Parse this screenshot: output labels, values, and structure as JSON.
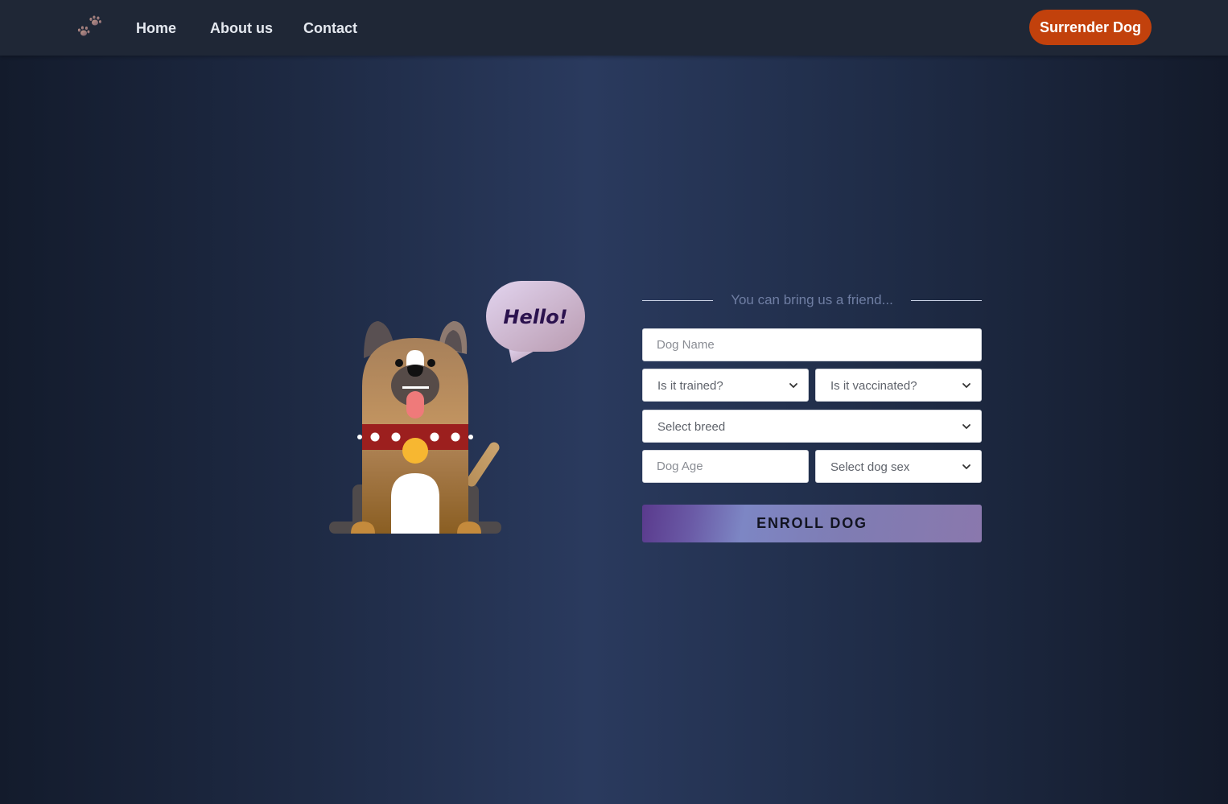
{
  "nav": {
    "links": [
      {
        "label": "Home"
      },
      {
        "label": "About us"
      },
      {
        "label": "Contact"
      }
    ],
    "cta_label": "Surrender Dog"
  },
  "illustration": {
    "speech_bubble": "Hello!"
  },
  "form": {
    "heading": "You can bring us a friend...",
    "dog_name_placeholder": "Dog Name",
    "trained_select": "Is it trained?",
    "vaccinated_select": "Is it vaccinated?",
    "breed_select": "Select breed",
    "age_placeholder": "Dog Age",
    "sex_select": "Select dog sex",
    "submit_label": "ENROLL DOG"
  },
  "colors": {
    "cta": "#c2410c",
    "navbar": "#1f2736",
    "accent_purple": "#7d86c4"
  }
}
